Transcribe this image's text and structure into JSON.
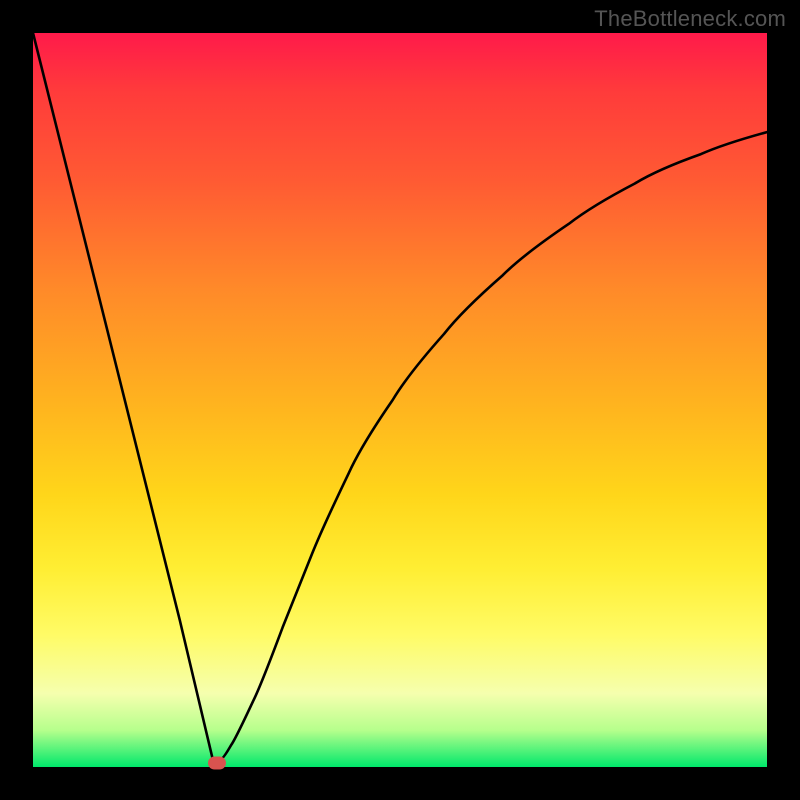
{
  "watermark": "TheBottleneck.com",
  "colors": {
    "frame": "#000000",
    "curve_stroke": "#000000",
    "marker_fill": "#d9534f",
    "gradient_stops": [
      "#ff1a4a",
      "#ff3b3b",
      "#ff5a33",
      "#ff8a29",
      "#ffb21f",
      "#ffd61a",
      "#ffee33",
      "#fffb66",
      "#f5ffae",
      "#b6ff8c",
      "#00e86b"
    ]
  },
  "chart_data": {
    "type": "line",
    "title": "",
    "xlabel": "",
    "ylabel": "",
    "xlim": [
      0,
      1
    ],
    "ylim": [
      0,
      1
    ],
    "notes": "Single V-shaped curve on a vertical heat gradient. Left branch is nearly linear from top-left down to the minimum; right branch rises with diminishing slope toward upper-right. Values are normalized to [0,1] since no axis ticks or labels are shown.",
    "series": [
      {
        "name": "curve",
        "x": [
          0.0,
          0.05,
          0.1,
          0.15,
          0.2,
          0.245,
          0.255,
          0.27,
          0.3,
          0.34,
          0.38,
          0.43,
          0.49,
          0.56,
          0.64,
          0.73,
          0.82,
          0.91,
          1.0
        ],
        "y": [
          1.0,
          0.8,
          0.6,
          0.4,
          0.2,
          0.01,
          0.01,
          0.03,
          0.09,
          0.19,
          0.29,
          0.4,
          0.5,
          0.59,
          0.67,
          0.74,
          0.795,
          0.835,
          0.865
        ]
      }
    ],
    "marker": {
      "x": 0.25,
      "y": 0.005,
      "shape": "rounded-rect"
    }
  }
}
